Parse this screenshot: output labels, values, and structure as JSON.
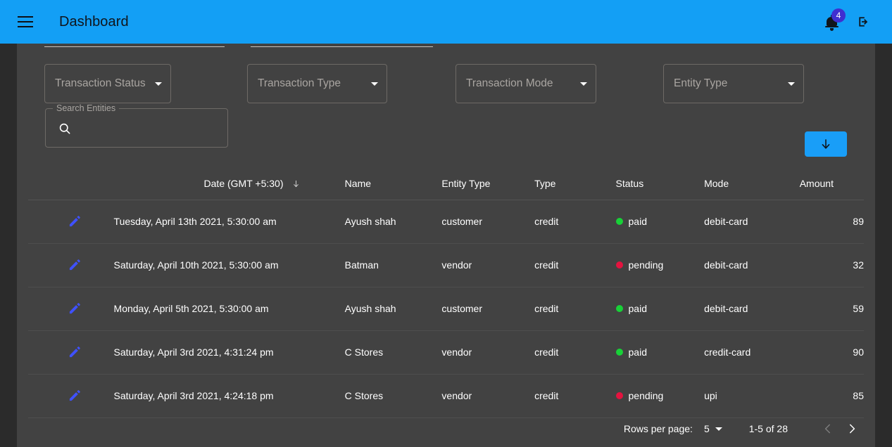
{
  "appbar": {
    "menu_icon": "hamburger-menu-icon",
    "title": "Dashboard",
    "notification_icon": "bell-icon",
    "notification_count": "4",
    "badge_color": "#3f2fd0",
    "logout_icon": "logout-icon",
    "background_color": "#139ff5"
  },
  "filters": {
    "selects": [
      {
        "label": "Transaction Status"
      },
      {
        "label": "Transaction Type"
      },
      {
        "label": "Transaction Mode"
      },
      {
        "label": "Entity Type"
      }
    ],
    "search": {
      "legend": "Search Entities",
      "value": "",
      "placeholder": "",
      "icon": "search-icon"
    },
    "download_button": {
      "icon": "arrow-down-icon",
      "label": "",
      "color": "#199ef8"
    }
  },
  "table": {
    "columns": [
      {
        "key": "edit",
        "label": ""
      },
      {
        "key": "date",
        "label": "Date (GMT +5:30)",
        "sort": "descending"
      },
      {
        "key": "name",
        "label": "Name"
      },
      {
        "key": "entity_type",
        "label": "Entity Type"
      },
      {
        "key": "type",
        "label": "Type"
      },
      {
        "key": "status",
        "label": "Status"
      },
      {
        "key": "mode",
        "label": "Mode"
      },
      {
        "key": "amount",
        "label": "Amount"
      }
    ],
    "rows": [
      {
        "date": "Tuesday, April 13th 2021, 5:30:00 am",
        "name": "Ayush shah",
        "entity_type": "customer",
        "type": "credit",
        "status": "paid",
        "status_color": "#18d137",
        "mode": "debit-card",
        "amount": "89"
      },
      {
        "date": "Saturday, April 10th 2021, 5:30:00 am",
        "name": "Batman",
        "entity_type": "vendor",
        "type": "credit",
        "status": "pending",
        "status_color": "#e4133f",
        "mode": "debit-card",
        "amount": "32"
      },
      {
        "date": "Monday, April 5th 2021, 5:30:00 am",
        "name": "Ayush shah",
        "entity_type": "customer",
        "type": "credit",
        "status": "paid",
        "status_color": "#18d137",
        "mode": "debit-card",
        "amount": "59"
      },
      {
        "date": "Saturday, April 3rd 2021, 4:31:24 pm",
        "name": "C Stores",
        "entity_type": "vendor",
        "type": "credit",
        "status": "paid",
        "status_color": "#18d137",
        "mode": "credit-card",
        "amount": "90"
      },
      {
        "date": "Saturday, April 3rd 2021, 4:24:18 pm",
        "name": "C Stores",
        "entity_type": "vendor",
        "type": "credit",
        "status": "pending",
        "status_color": "#e4133f",
        "mode": "upi",
        "amount": "85"
      }
    ]
  },
  "pagination": {
    "rows_per_page_label": "Rows per page:",
    "rows_per_page_value": "5",
    "displayed_rows": "1-5 of 28",
    "prev_icon": "chevron-left-icon",
    "next_icon": "chevron-right-icon",
    "prev_disabled": true
  }
}
